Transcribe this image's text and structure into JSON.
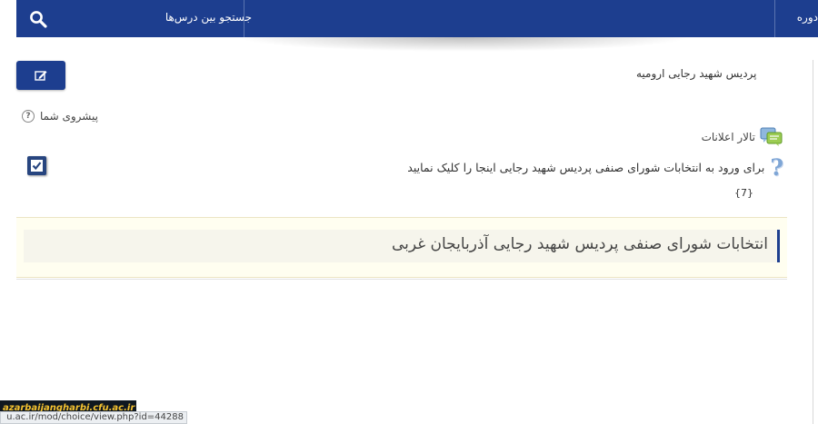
{
  "header": {
    "search_label": "جستجو بین درس‌ها",
    "course_label": "دوره"
  },
  "breadcrumb": "پردیس شهید رجایی ارومیه",
  "progress": {
    "label": "پیشروی شما",
    "help_symbol": "?"
  },
  "forum": {
    "label": "تالار اعلانات"
  },
  "choice": {
    "link_text": "برای ورود به انتخابات شورای صنفی پردیس شهید رجایی اینجا را کلیک نمایید",
    "count": "{7}"
  },
  "section": {
    "title": "انتخابات شورای صنفی پردیس شهید رجایی آذربایجان غربی"
  },
  "watermark": "azarbaijangharbi.cfu.ac.ir",
  "status_url": "u.ac.ir/mod/choice/view.php?id=44288",
  "colors": {
    "primary": "#1d3e8f",
    "section_bg": "#fffef0",
    "link_icon": "#7fa6d6"
  },
  "icons": {
    "search": "search-icon",
    "edit": "edit-icon",
    "help": "help-icon",
    "forum": "forum-icon",
    "choice": "question-mark-icon",
    "checkbox": "checkbox-icon"
  }
}
